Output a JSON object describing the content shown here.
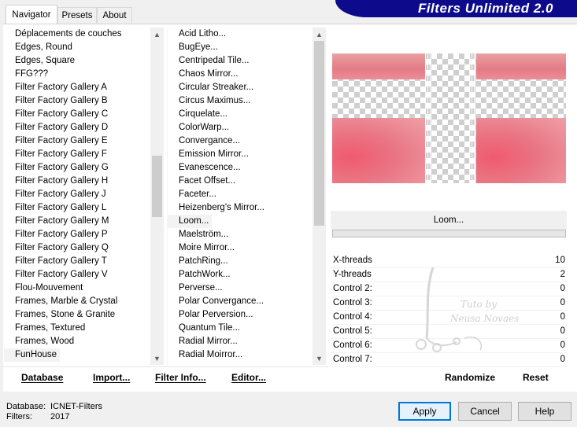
{
  "tabs": [
    {
      "label": "Navigator"
    },
    {
      "label": "Presets"
    },
    {
      "label": "About"
    }
  ],
  "banner": {
    "title": "Filters Unlimited 2.0"
  },
  "categories": {
    "items": [
      "Déplacements de couches",
      "Edges, Round",
      "Edges, Square",
      "FFG???",
      "Filter Factory Gallery A",
      "Filter Factory Gallery B",
      "Filter Factory Gallery C",
      "Filter Factory Gallery D",
      "Filter Factory Gallery E",
      "Filter Factory Gallery F",
      "Filter Factory Gallery G",
      "Filter Factory Gallery H",
      "Filter Factory Gallery J",
      "Filter Factory Gallery L",
      "Filter Factory Gallery M",
      "Filter Factory Gallery P",
      "Filter Factory Gallery Q",
      "Filter Factory Gallery T",
      "Filter Factory Gallery V",
      "Flou-Mouvement",
      "Frames, Marble & Crystal",
      "Frames, Stone & Granite",
      "Frames, Textured",
      "Frames, Wood",
      "FunHouse"
    ],
    "selected": "FunHouse"
  },
  "filters": {
    "items": [
      "Acid Litho...",
      "BugEye...",
      "Centripedal Tile...",
      "Chaos Mirror...",
      "Circular Streaker...",
      "Circus Maximus...",
      "Cirquelate...",
      "ColorWarp...",
      "Convergance...",
      "Emission Mirror...",
      "Evanescence...",
      "Facet Offset...",
      "Faceter...",
      "Heizenberg's Mirror...",
      "Loom...",
      "Maelström...",
      "Moire Mirror...",
      "PatchRing...",
      "PatchWork...",
      "Perverse...",
      "Polar Convergance...",
      "Polar Perversion...",
      "Quantum Tile...",
      "Radial Mirror...",
      "Radial Moirror..."
    ],
    "selected": "Loom..."
  },
  "left_buttons": {
    "database": "Database",
    "import": "Import...",
    "filter_info": "Filter Info...",
    "editor": "Editor..."
  },
  "selected_filter_name": "Loom...",
  "parameters": [
    {
      "label": "X-threads",
      "value": "10"
    },
    {
      "label": "Y-threads",
      "value": "2"
    },
    {
      "label": "Control 2:",
      "value": "0"
    },
    {
      "label": "Control 3:",
      "value": "0"
    },
    {
      "label": "Control 4:",
      "value": "0"
    },
    {
      "label": "Control 5:",
      "value": "0"
    },
    {
      "label": "Control 6:",
      "value": "0"
    },
    {
      "label": "Control 7:",
      "value": "0"
    }
  ],
  "watermark": {
    "line1": "Tuto by",
    "line2": "Neusa Novaes"
  },
  "right_buttons": {
    "randomize": "Randomize",
    "reset": "Reset"
  },
  "status": {
    "database_label": "Database:",
    "database_value": "ICNET-Filters",
    "filters_label": "Filters:",
    "filters_value": "2017"
  },
  "dialog_buttons": {
    "apply": "Apply",
    "cancel": "Cancel",
    "help": "Help"
  },
  "colors": {
    "banner": "#0d0b8c",
    "accent": "#0078d7"
  }
}
